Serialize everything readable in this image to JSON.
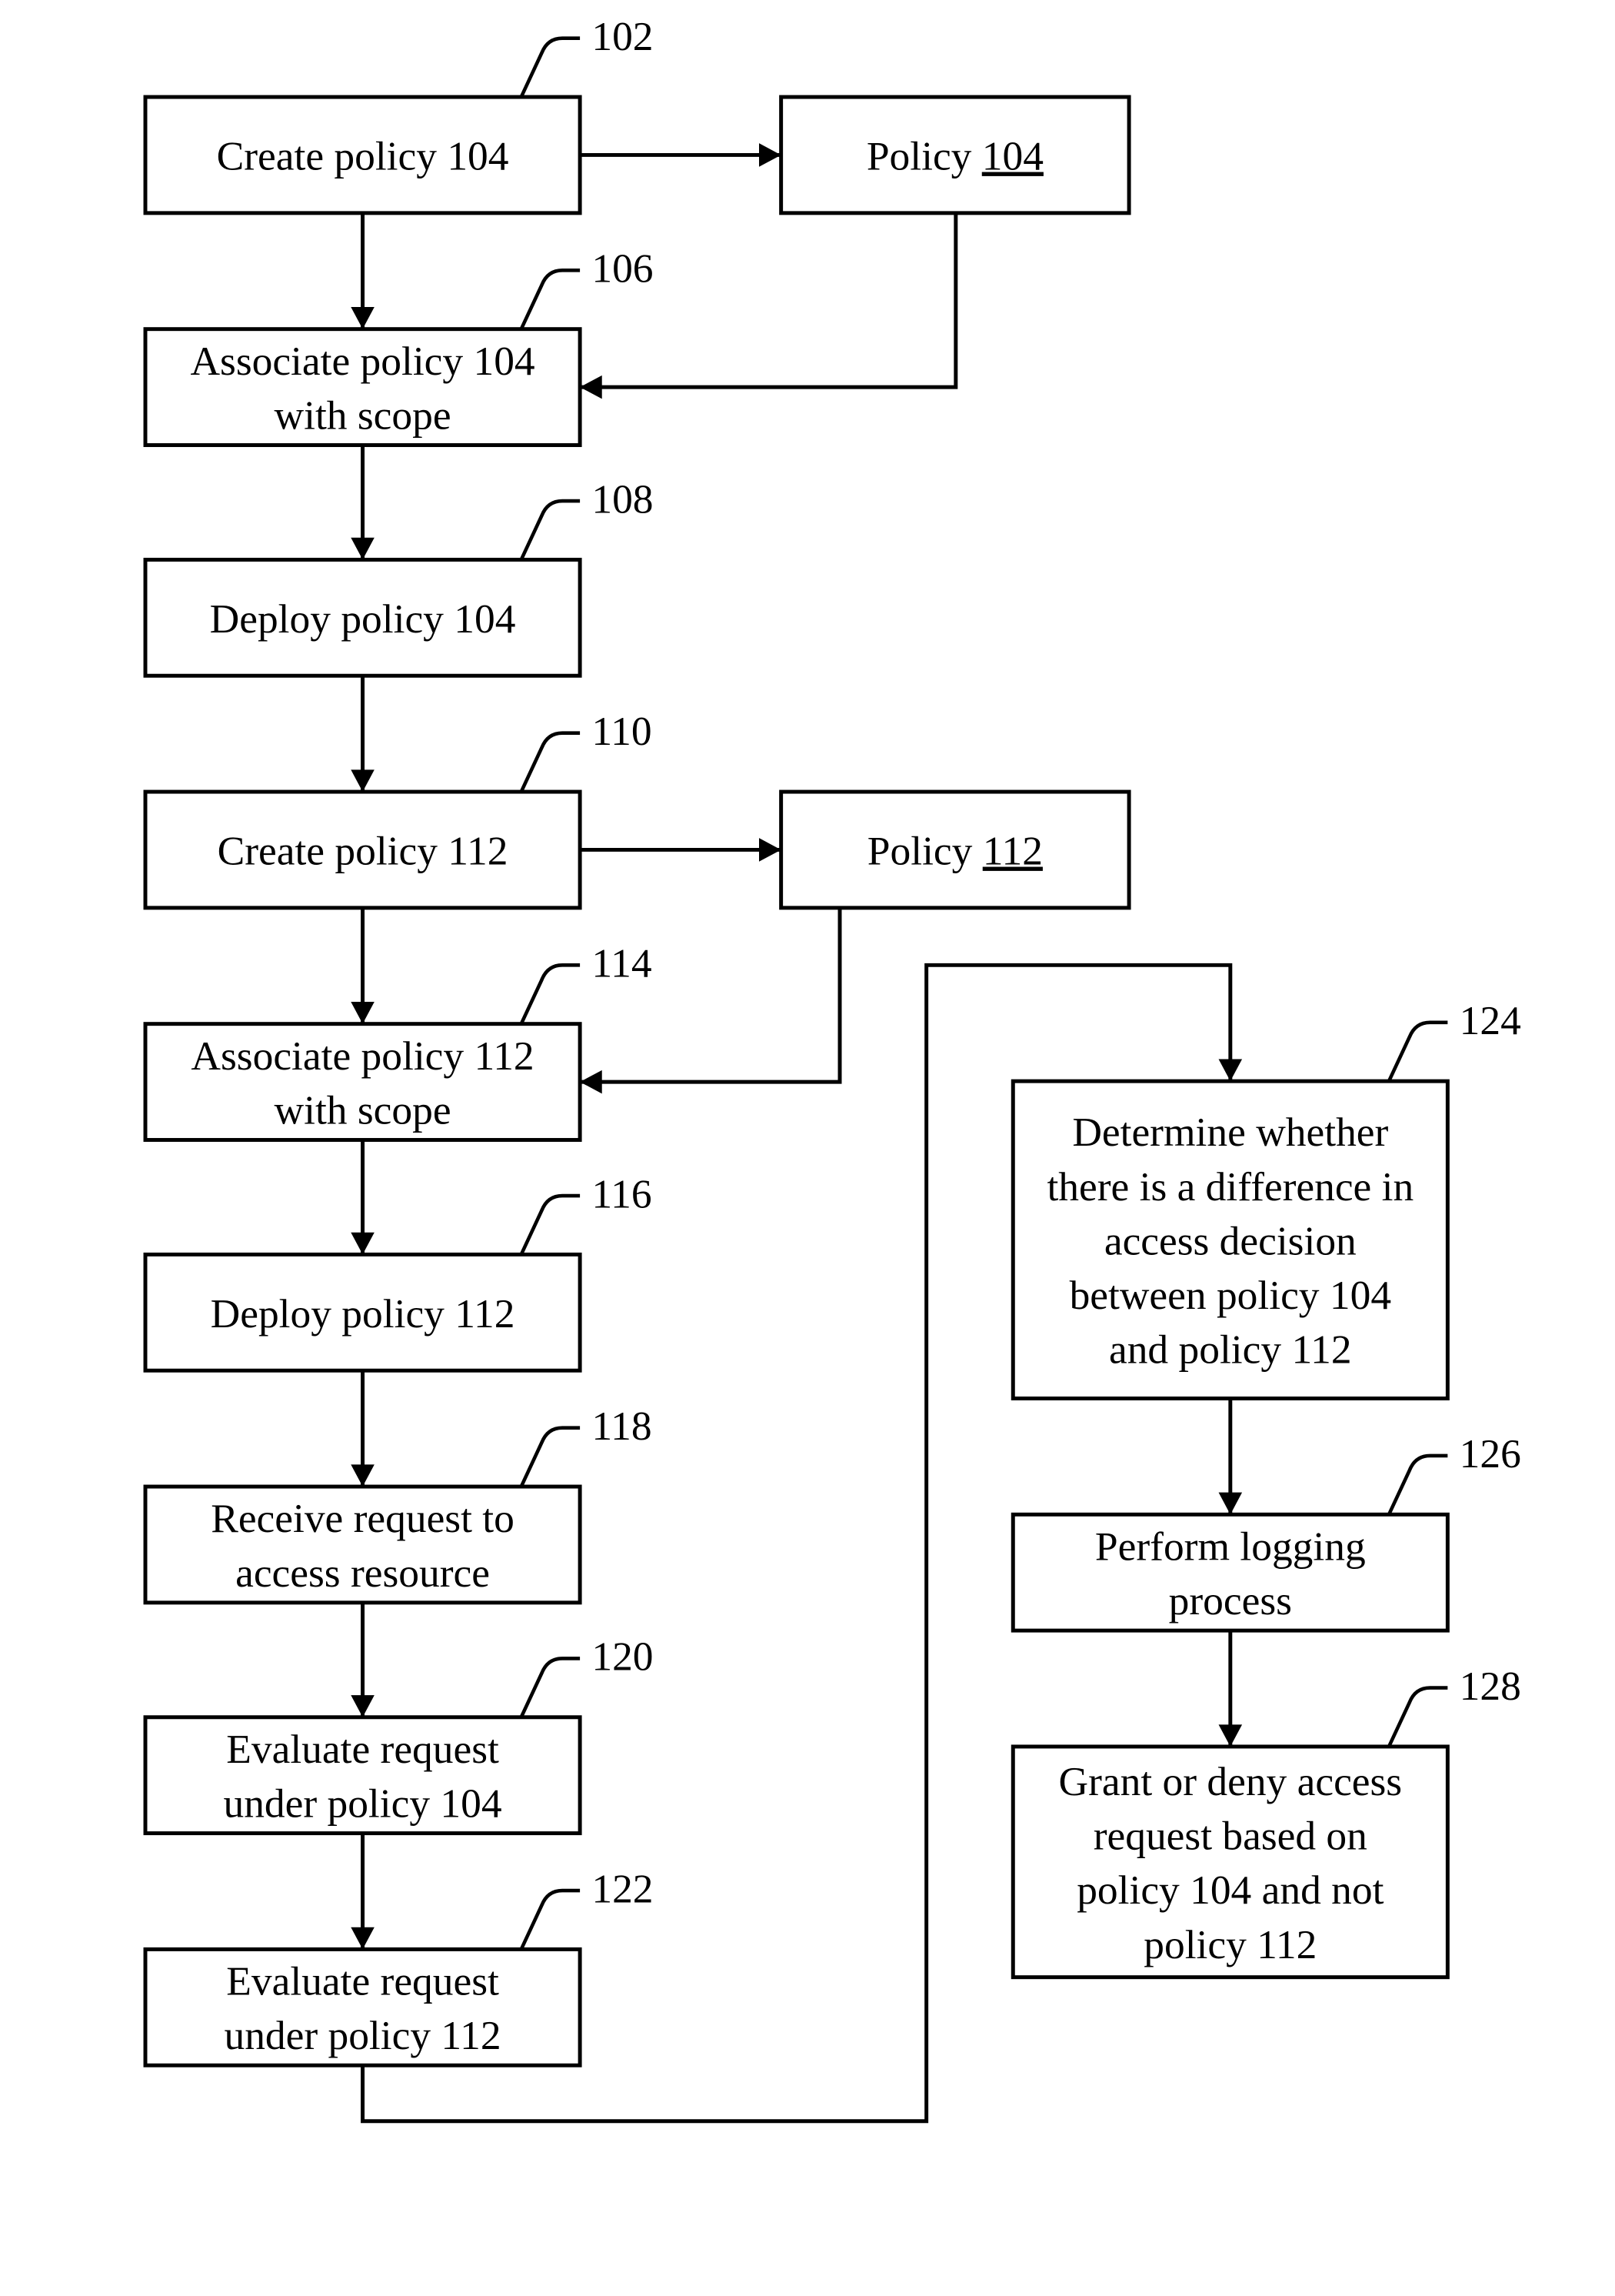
{
  "diagram": {
    "type": "flowchart",
    "nodes": [
      {
        "id": "n102",
        "ref": "102",
        "lines": [
          "Create policy 104"
        ]
      },
      {
        "id": "p104",
        "ref": "",
        "lines": [
          "Policy "
        ],
        "underlined": "104"
      },
      {
        "id": "n106",
        "ref": "106",
        "lines": [
          "Associate policy 104",
          "with scope"
        ]
      },
      {
        "id": "n108",
        "ref": "108",
        "lines": [
          "Deploy policy 104"
        ]
      },
      {
        "id": "n110",
        "ref": "110",
        "lines": [
          "Create policy 112"
        ]
      },
      {
        "id": "p112",
        "ref": "",
        "lines": [
          "Policy "
        ],
        "underlined": "112"
      },
      {
        "id": "n114",
        "ref": "114",
        "lines": [
          "Associate policy 112",
          "with scope"
        ]
      },
      {
        "id": "n116",
        "ref": "116",
        "lines": [
          "Deploy policy 112"
        ]
      },
      {
        "id": "n118",
        "ref": "118",
        "lines": [
          "Receive request to",
          "access resource"
        ]
      },
      {
        "id": "n120",
        "ref": "120",
        "lines": [
          "Evaluate request",
          "under policy 104"
        ]
      },
      {
        "id": "n122",
        "ref": "122",
        "lines": [
          "Evaluate request",
          "under policy 112"
        ]
      },
      {
        "id": "n124",
        "ref": "124",
        "lines": [
          "Determine whether",
          "there is a difference in",
          "access decision",
          "between policy 104",
          "and policy 112"
        ]
      },
      {
        "id": "n126",
        "ref": "126",
        "lines": [
          "Perform logging",
          "process"
        ]
      },
      {
        "id": "n128",
        "ref": "128",
        "lines": [
          "Grant or deny access",
          "request based on",
          "policy 104 and not",
          "policy 112"
        ]
      }
    ],
    "edges": [
      {
        "from": "n102",
        "to": "p104"
      },
      {
        "from": "n102",
        "to": "n106"
      },
      {
        "from": "p104",
        "to": "n106"
      },
      {
        "from": "n106",
        "to": "n108"
      },
      {
        "from": "n108",
        "to": "n110"
      },
      {
        "from": "n110",
        "to": "p112"
      },
      {
        "from": "n110",
        "to": "n114"
      },
      {
        "from": "p112",
        "to": "n114"
      },
      {
        "from": "n114",
        "to": "n116"
      },
      {
        "from": "n116",
        "to": "n118"
      },
      {
        "from": "n118",
        "to": "n120"
      },
      {
        "from": "n120",
        "to": "n122"
      },
      {
        "from": "n122",
        "to": "n124"
      },
      {
        "from": "n124",
        "to": "n126"
      },
      {
        "from": "n126",
        "to": "n128"
      }
    ]
  }
}
